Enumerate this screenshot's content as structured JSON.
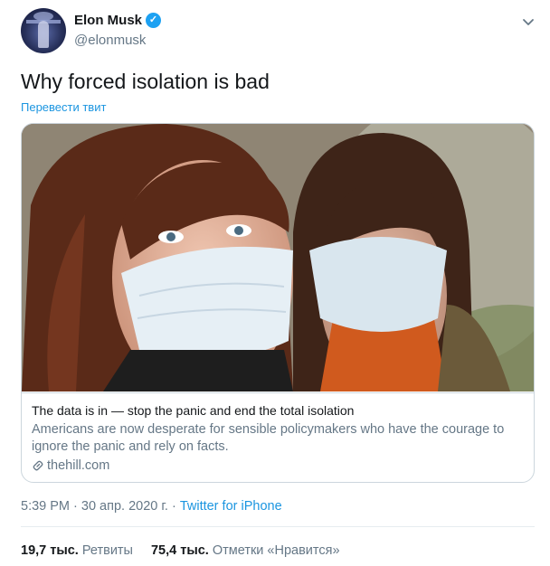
{
  "author": {
    "name": "Elon Musk",
    "handle": "@elonmusk",
    "verified_glyph": "✓"
  },
  "tweet": {
    "text": "Why forced isolation is bad",
    "translate_label": "Перевести твит"
  },
  "card": {
    "title": "The data is in — stop the panic and end the total isolation",
    "description": "Americans are now desperate for sensible policymakers who have the courage to ignore the panic and rely on facts.",
    "domain": "thehill.com"
  },
  "meta": {
    "time": "5:39 PM",
    "separator": " · ",
    "date": "30 апр. 2020 г.",
    "source": "Twitter for iPhone"
  },
  "stats": {
    "retweets_count": "19,7 тыс.",
    "retweets_label": "Ретвиты",
    "likes_count": "75,4 тыс.",
    "likes_label": "Отметки «Нравится»"
  },
  "colors": {
    "accent": "#1b95e0",
    "verified": "#1da1f2",
    "muted": "#657786"
  }
}
